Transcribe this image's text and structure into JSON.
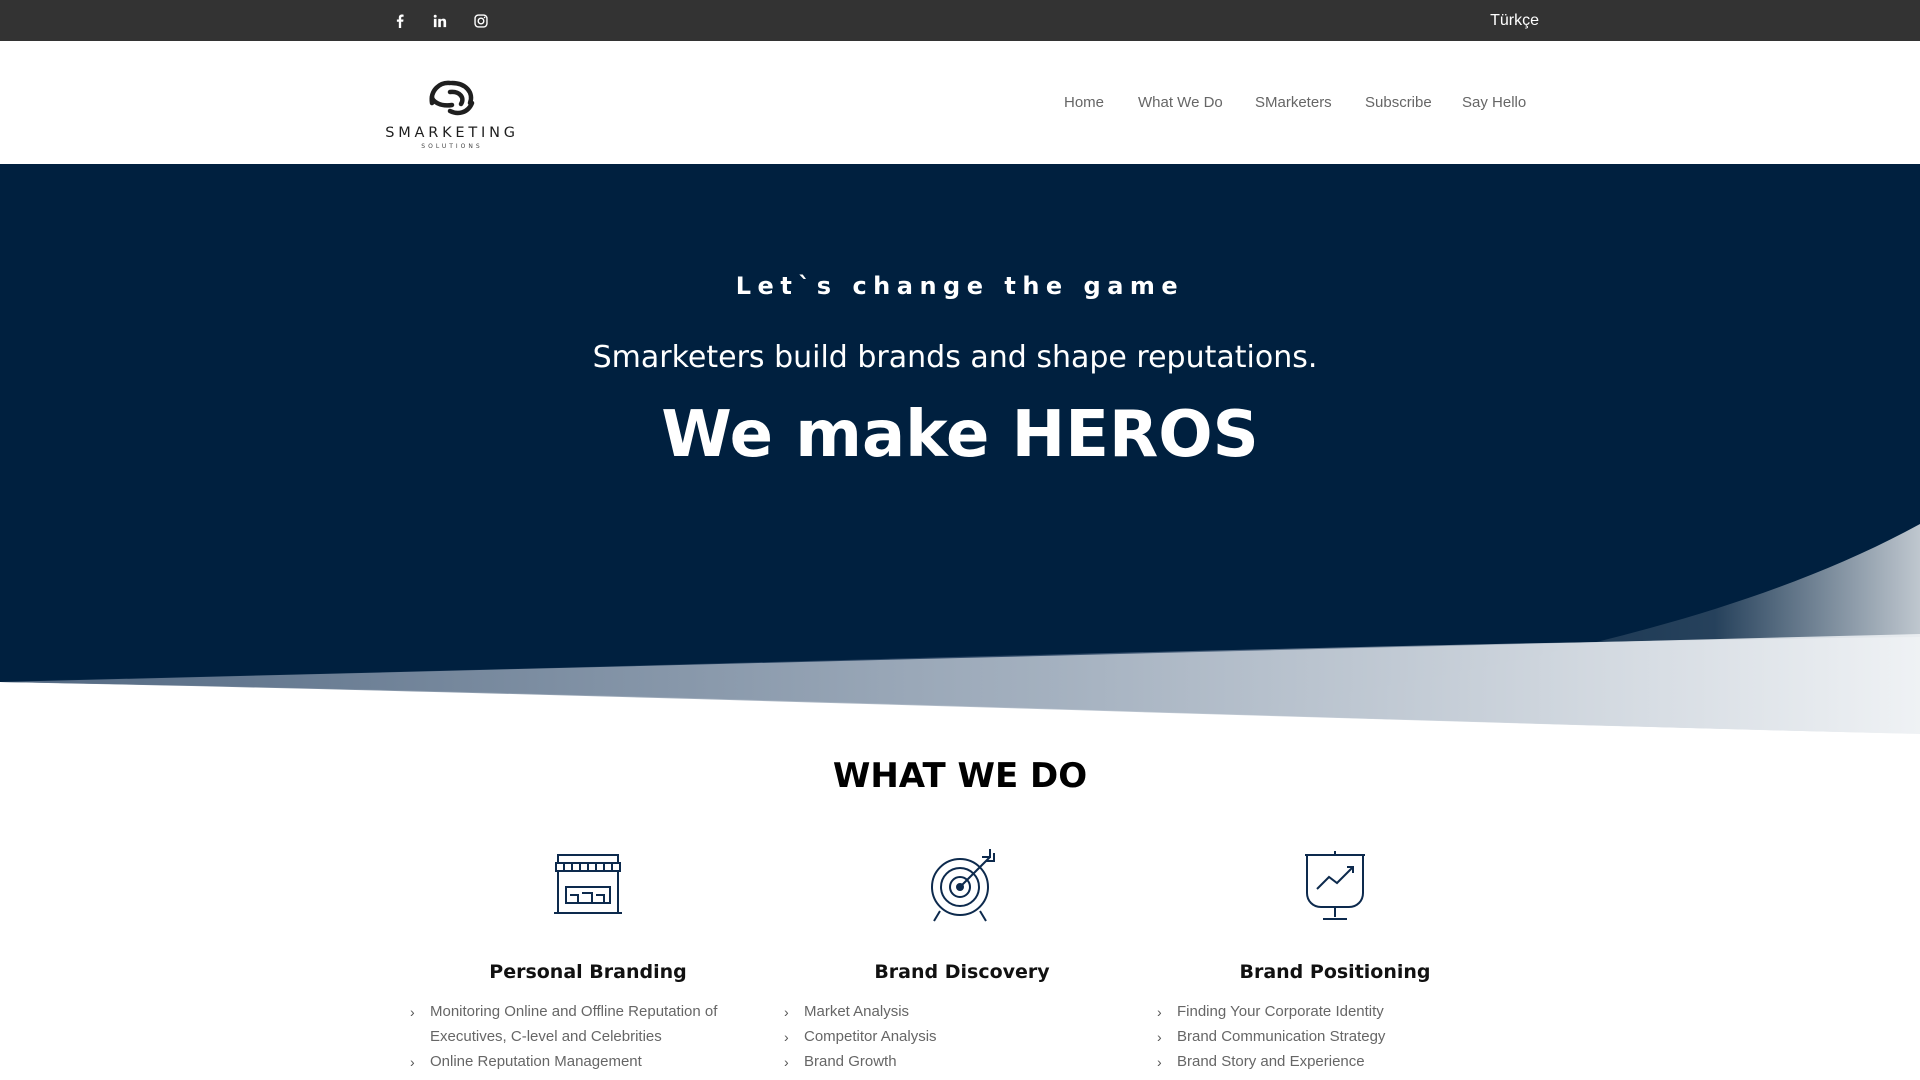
{
  "topbar": {
    "social": [
      {
        "name": "facebook-icon"
      },
      {
        "name": "linkedin-icon"
      },
      {
        "name": "instagram-icon"
      }
    ],
    "language": "Türkçe"
  },
  "header": {
    "logo_text": "SMARKETING",
    "logo_subtext": "SOLUTIONS",
    "nav": [
      "Home",
      "What We Do",
      "SMarketers",
      "Subscribe",
      "Say Hello"
    ]
  },
  "hero": {
    "tagline": "Let`s change the game",
    "subtitle": "Smarketers build brands and shape reputations.",
    "headline": "We make HEROS",
    "background": "#00203f"
  },
  "what_we_do": {
    "title": "WHAT WE DO",
    "services": [
      {
        "icon": "storefront-icon",
        "title": "Personal Branding",
        "items": [
          "Monitoring Online and Offline Reputation of Executives, C-level and Celebrities",
          "Online Reputation Management"
        ]
      },
      {
        "icon": "target-arrow-icon",
        "title": "Brand Discovery",
        "items": [
          "Market Analysis",
          "Competitor Analysis",
          "Brand Growth"
        ]
      },
      {
        "icon": "presentation-chart-icon",
        "title": "Brand Positioning",
        "items": [
          "Finding Your Corporate Identity",
          "Brand Communication Strategy",
          "Brand Story and Experience"
        ]
      }
    ]
  }
}
